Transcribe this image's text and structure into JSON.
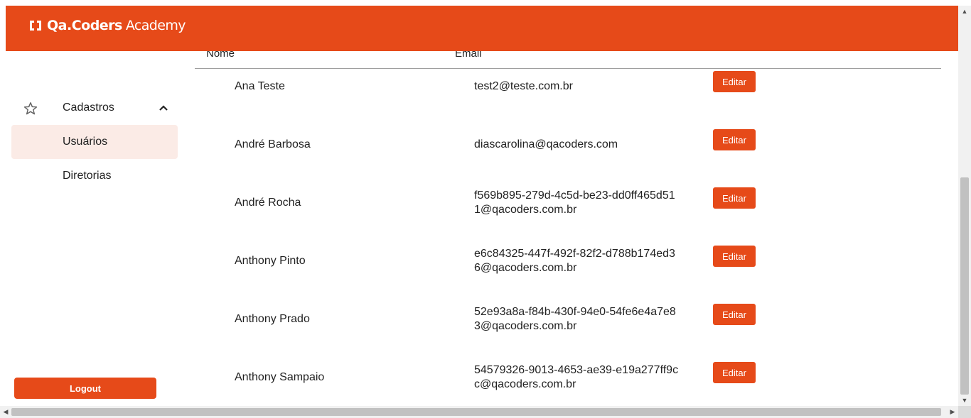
{
  "brand": {
    "name": "Qa.Coders",
    "suffix": "Academy"
  },
  "sidebar": {
    "group": {
      "label": "Cadastros",
      "icon": "star-outline-icon",
      "expand_icon": "chevron-up-icon"
    },
    "items": [
      {
        "label": "Usuários",
        "active": true
      },
      {
        "label": "Diretorias",
        "active": false
      }
    ],
    "logout_label": "Logout"
  },
  "table": {
    "columns": {
      "name": "Nome",
      "email": "Email"
    },
    "edit_label": "Editar",
    "rows": [
      {
        "name": "Ana Teste",
        "email": "test2@teste.com.br"
      },
      {
        "name": "André Barbosa",
        "email": "diascarolina@qacoders.com"
      },
      {
        "name": "André Rocha",
        "email": "f569b895-279d-4c5d-be23-dd0ff465d511@qacoders.com.br"
      },
      {
        "name": "Anthony Pinto",
        "email": "e6c84325-447f-492f-82f2-d788b174ed36@qacoders.com.br"
      },
      {
        "name": "Anthony Prado",
        "email": "52e93a8a-f84b-430f-94e0-54fe6e4a7e83@qacoders.com.br"
      },
      {
        "name": "Anthony Sampaio",
        "email": "54579326-9013-4653-ae39-e19a277ff9cc@qacoders.com.br"
      }
    ]
  },
  "colors": {
    "brand": "#e64a19",
    "active_bg": "#fbebe6"
  }
}
